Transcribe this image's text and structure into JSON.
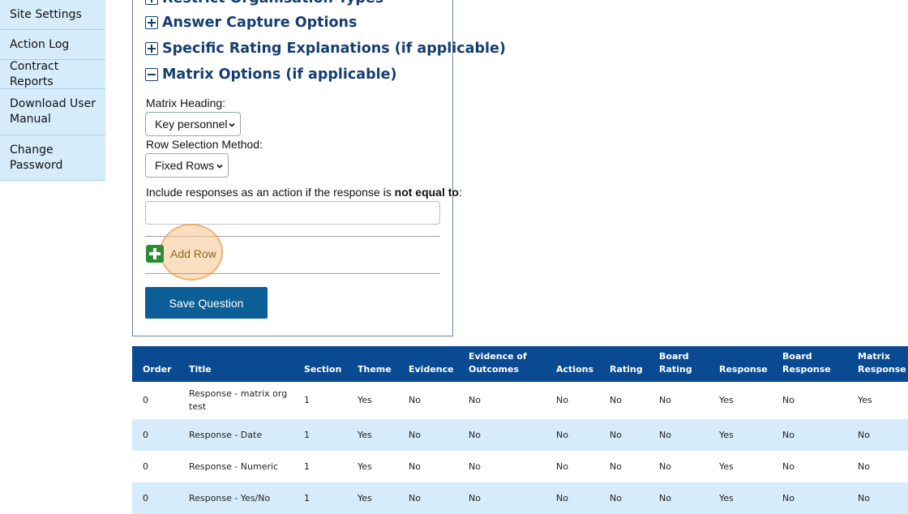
{
  "sidebar": {
    "items": [
      {
        "label": "Site Settings"
      },
      {
        "label": "Action Log"
      },
      {
        "label": "Contract Reports"
      },
      {
        "label": "Download User Manual"
      },
      {
        "label": "Change Password"
      }
    ]
  },
  "panel": {
    "sections": [
      {
        "label": "Restrict Organisation Types",
        "state": "collapsed"
      },
      {
        "label": "Answer Capture Options",
        "state": "collapsed"
      },
      {
        "label": "Specific Rating Explanations (if applicable)",
        "state": "collapsed"
      },
      {
        "label": "Matrix Options (if applicable)",
        "state": "expanded"
      }
    ],
    "matrix_heading_label": "Matrix Heading:",
    "matrix_heading_value": "Key personnel",
    "row_selection_label": "Row Selection Method:",
    "row_selection_value": "Fixed Rows",
    "include_label_prefix": "Include responses as an action if the response is ",
    "include_label_bold": "not equal to",
    "include_label_suffix": ":",
    "include_value": "",
    "add_row_label": "Add Row",
    "save_label": "Save Question"
  },
  "table": {
    "headers": [
      {
        "l1": "",
        "l2": "Order"
      },
      {
        "l1": "",
        "l2": "Title"
      },
      {
        "l1": "",
        "l2": "Section"
      },
      {
        "l1": "",
        "l2": "Theme"
      },
      {
        "l1": "",
        "l2": "Evidence"
      },
      {
        "l1": "Evidence of",
        "l2": "Outcomes"
      },
      {
        "l1": "",
        "l2": "Actions"
      },
      {
        "l1": "",
        "l2": "Rating"
      },
      {
        "l1": "Board",
        "l2": "Rating"
      },
      {
        "l1": "",
        "l2": "Response"
      },
      {
        "l1": "Board",
        "l2": "Response"
      },
      {
        "l1": "Matrix",
        "l2": "Response"
      }
    ],
    "rows": [
      [
        "0",
        "Response - matrix org test",
        "1",
        "Yes",
        "No",
        "No",
        "No",
        "No",
        "No",
        "Yes",
        "No",
        "Yes"
      ],
      [
        "0",
        "Response - Date",
        "1",
        "Yes",
        "No",
        "No",
        "No",
        "No",
        "No",
        "Yes",
        "No",
        "No"
      ],
      [
        "0",
        "Response - Numeric",
        "1",
        "Yes",
        "No",
        "No",
        "No",
        "No",
        "No",
        "Yes",
        "No",
        "No"
      ],
      [
        "0",
        "Response - Yes/No",
        "1",
        "Yes",
        "No",
        "No",
        "No",
        "No",
        "No",
        "Yes",
        "No",
        "No"
      ]
    ]
  },
  "colors": {
    "sidebar_bg": "#d6ecfb",
    "heading": "#153e73",
    "table_header": "#0a4a93",
    "button": "#0c5e96",
    "add_icon": "#2e8a35"
  }
}
